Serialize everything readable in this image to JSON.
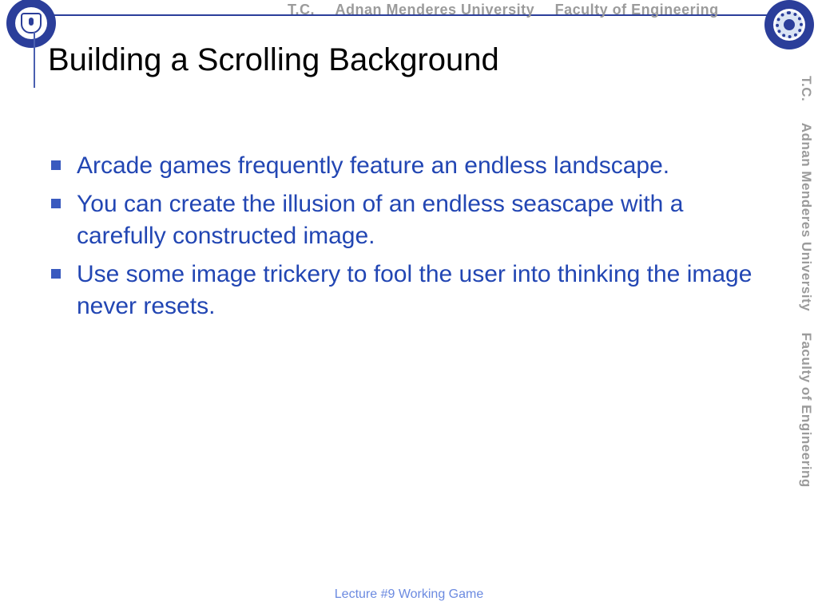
{
  "header": {
    "tc": "T.C.",
    "university": "Adnan Menderes University",
    "faculty": "Faculty of Engineering"
  },
  "side": {
    "tc": "T.C.",
    "university": "Adnan Menderes University",
    "faculty": "Faculty of Engineering"
  },
  "slide": {
    "title": "Building a Scrolling Background",
    "bullets": [
      "Arcade games frequently feature an endless landscape.",
      "You can create the illusion of an endless seascape with a carefully constructed image.",
      "Use some image trickery to fool the user into thinking the image never resets."
    ]
  },
  "footer": "Lecture #9 Working Game"
}
